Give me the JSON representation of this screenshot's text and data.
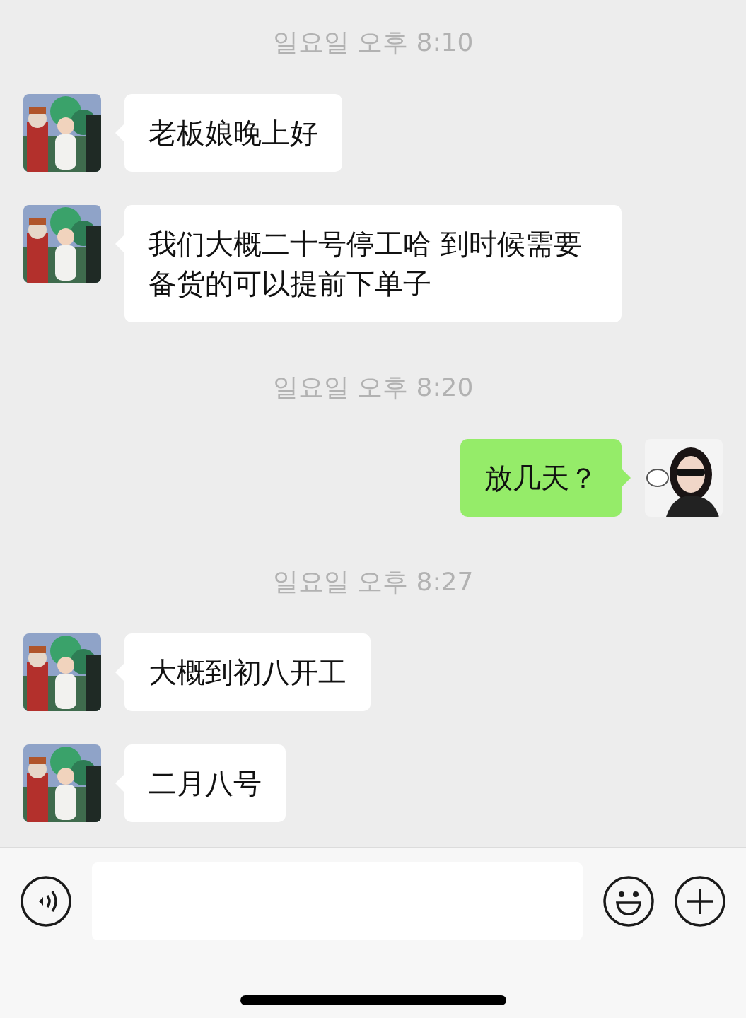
{
  "messages": [
    {
      "kind": "time",
      "text": "일요일 오후 8:10"
    },
    {
      "kind": "message",
      "outgoing": false,
      "text": "老板娘晚上好"
    },
    {
      "kind": "message",
      "outgoing": false,
      "text": "我们大概二十号停工哈 到时候需要备货的可以提前下单子"
    },
    {
      "kind": "time",
      "text": "일요일 오후 8:20"
    },
    {
      "kind": "message",
      "outgoing": true,
      "text": "放几天？"
    },
    {
      "kind": "time",
      "text": "일요일 오후 8:27"
    },
    {
      "kind": "message",
      "outgoing": false,
      "text": "大概到初八开工"
    },
    {
      "kind": "message",
      "outgoing": false,
      "text": "二月八号"
    }
  ]
}
